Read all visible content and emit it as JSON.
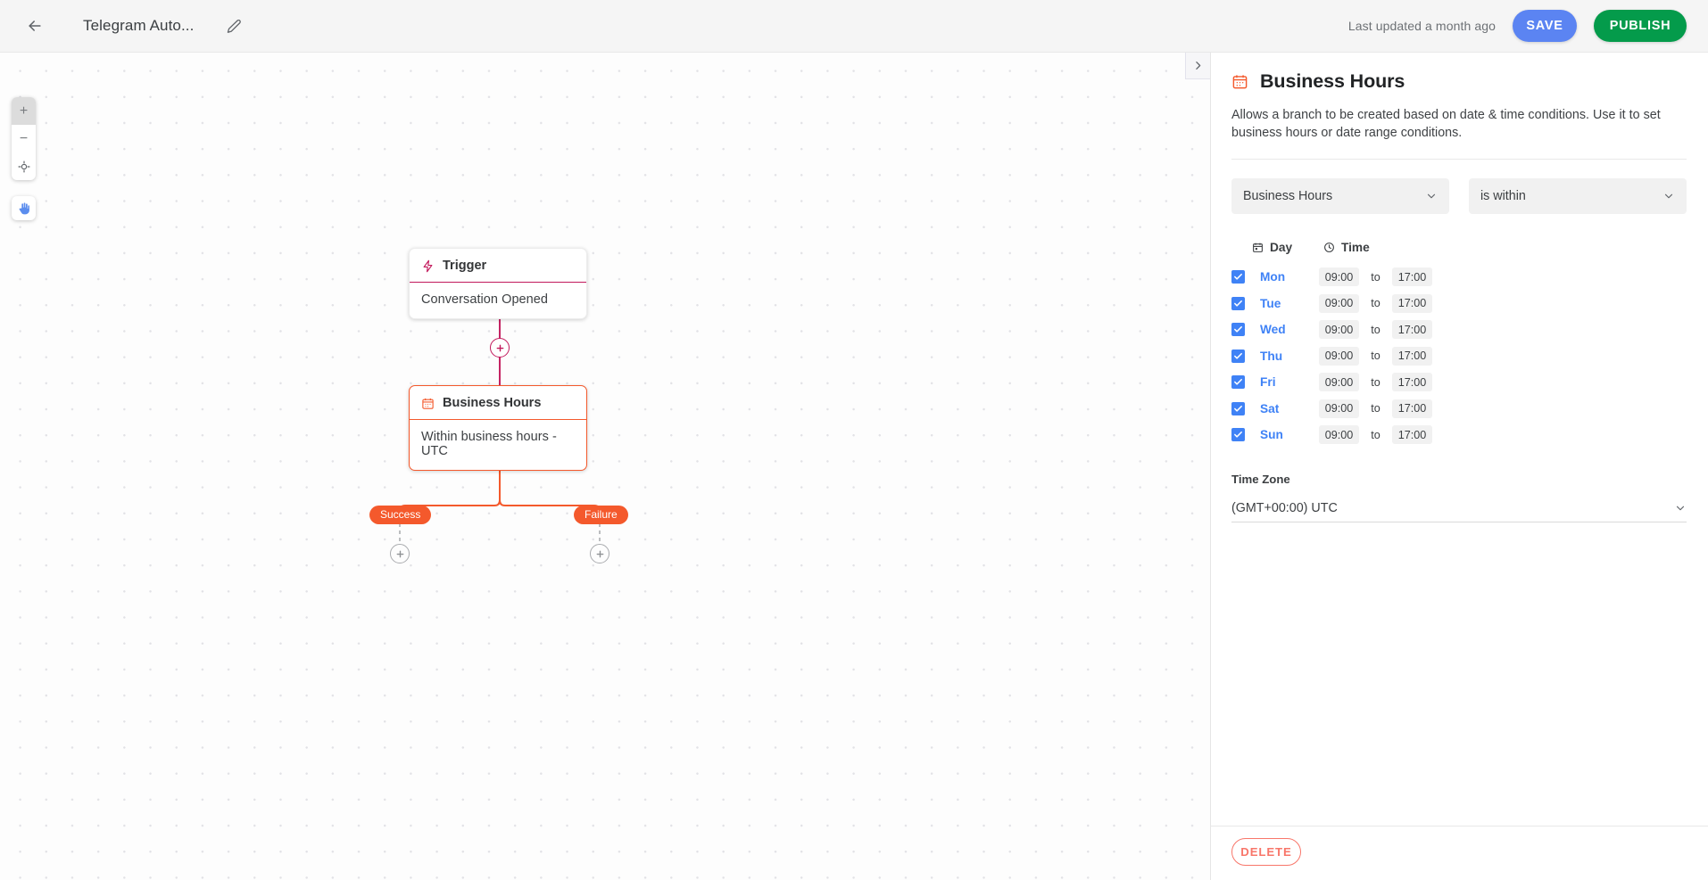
{
  "topbar": {
    "back_icon": "arrow-left-icon",
    "title": "Telegram Auto...",
    "edit_icon": "pencil-icon",
    "last_updated": "Last updated a month ago",
    "save_label": "SAVE",
    "publish_label": "PUBLISH",
    "save_color": "#5b84f2",
    "publish_color": "#049b4b"
  },
  "canvas": {
    "zoom_in": "+",
    "zoom_out": "−",
    "recenter_icon": "crosshair-icon",
    "pan_icon": "hand-icon",
    "collapse_icon": "chevron-right-icon",
    "nodes": [
      {
        "id": "trigger",
        "icon": "lightning-bolt-icon",
        "title": "Trigger",
        "body": "Conversation Opened",
        "accent": "#c2185b",
        "selected": false
      },
      {
        "id": "business-hours",
        "icon": "calendar-icon",
        "title": "Business Hours",
        "body": "Within business hours - UTC",
        "accent": "#f4592c",
        "selected": true
      }
    ],
    "branches": [
      {
        "label": "Success",
        "color": "#f4592c"
      },
      {
        "label": "Failure",
        "color": "#f4592c"
      }
    ]
  },
  "panel": {
    "icon": "calendar-icon",
    "title": "Business Hours",
    "description": "Allows a branch to be created based on date & time conditions. Use it to set business hours or date range conditions.",
    "condition_type": "Business Hours",
    "condition_operator": "is within",
    "table": {
      "day_header": "Day",
      "day_header_icon": "calendar-icon",
      "time_header": "Time",
      "time_header_icon": "clock-icon",
      "to_label": "to",
      "rows": [
        {
          "day": "Mon",
          "checked": true,
          "from": "09:00",
          "to": "17:00"
        },
        {
          "day": "Tue",
          "checked": true,
          "from": "09:00",
          "to": "17:00"
        },
        {
          "day": "Wed",
          "checked": true,
          "from": "09:00",
          "to": "17:00"
        },
        {
          "day": "Thu",
          "checked": true,
          "from": "09:00",
          "to": "17:00"
        },
        {
          "day": "Fri",
          "checked": true,
          "from": "09:00",
          "to": "17:00"
        },
        {
          "day": "Sat",
          "checked": true,
          "from": "09:00",
          "to": "17:00"
        },
        {
          "day": "Sun",
          "checked": true,
          "from": "09:00",
          "to": "17:00"
        }
      ]
    },
    "timezone_label": "Time Zone",
    "timezone_value": "(GMT+00:00) UTC",
    "delete_label": "DELETE",
    "delete_color": "#f8766a"
  }
}
